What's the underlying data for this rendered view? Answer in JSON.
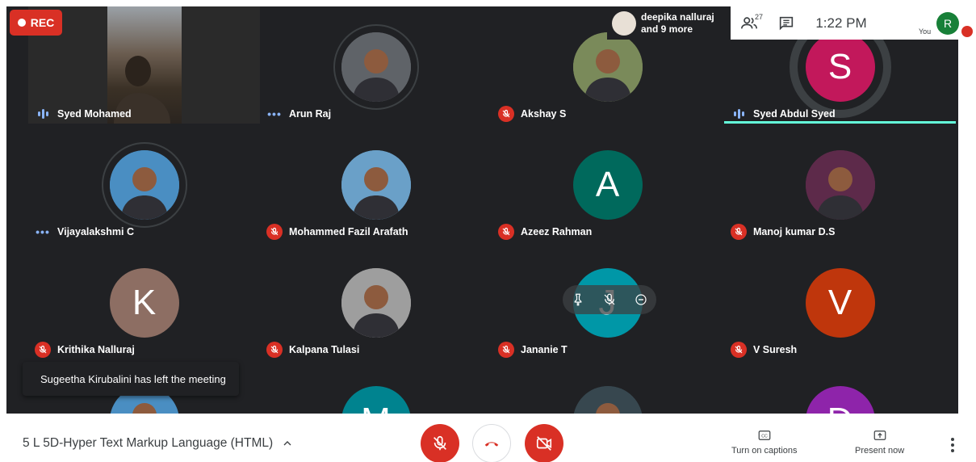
{
  "recording": {
    "label": "REC"
  },
  "presenter": {
    "text_line1": "deepika nalluraj",
    "text_line2": "and 9 more"
  },
  "infobar": {
    "participant_count": "27",
    "time": "1:22 PM",
    "self_initial": "R",
    "self_label": "You"
  },
  "tiles": [
    {
      "name": "Syed Mohamed",
      "status": "speaking",
      "kind": "video"
    },
    {
      "name": "Arun Raj",
      "status": "active",
      "kind": "photo",
      "color": "#5f6368"
    },
    {
      "name": "Akshay S",
      "status": "muted",
      "kind": "photo",
      "color": "#7a8a5a"
    },
    {
      "name": "Syed Abdul Syed",
      "status": "speaking",
      "kind": "initial",
      "initial": "S",
      "color": "#c2185b"
    },
    {
      "name": "Vijayalakshmi C",
      "status": "active",
      "kind": "photo",
      "color": "#4a8ec2"
    },
    {
      "name": "Mohammed Fazil Arafath",
      "status": "muted",
      "kind": "photo",
      "color": "#6aa0c8"
    },
    {
      "name": "Azeez Rahman",
      "status": "muted",
      "kind": "initial",
      "initial": "A",
      "color": "#00695c"
    },
    {
      "name": "Manoj kumar D.S",
      "status": "muted",
      "kind": "photo",
      "color": "#5d2a4a"
    },
    {
      "name": "Krithika Nalluraj",
      "status": "muted",
      "kind": "initial",
      "initial": "K",
      "color": "#8d6e63"
    },
    {
      "name": "Kalpana Tulasi",
      "status": "muted",
      "kind": "photo",
      "color": "#9e9e9e"
    },
    {
      "name": "Jananie T",
      "status": "muted",
      "kind": "initial",
      "initial": "J",
      "color": "#0097a7"
    },
    {
      "name": "V Suresh",
      "status": "muted",
      "kind": "initial",
      "initial": "V",
      "color": "#bf360c"
    },
    {
      "name": "",
      "status": "hidden",
      "kind": "photo",
      "color": "#4a8ec2"
    },
    {
      "name": "",
      "status": "hidden",
      "kind": "initial",
      "initial": "M",
      "color": "#00838f"
    },
    {
      "name": "",
      "status": "hidden",
      "kind": "photo",
      "color": "#37474f"
    },
    {
      "name": "",
      "status": "hidden",
      "kind": "initial",
      "initial": "D",
      "color": "#8e24aa"
    }
  ],
  "toast": {
    "message": "Sugeetha Kirubalini has left the meeting"
  },
  "bottombar": {
    "meeting_title": "5 L 5D-Hyper Text Markup Language (HTML)",
    "captions_label": "Turn on captions",
    "present_label": "Present now"
  },
  "colors": {
    "accent_red": "#d93025",
    "speaking_green": "#64ffda",
    "tile_bg": "#202124"
  }
}
